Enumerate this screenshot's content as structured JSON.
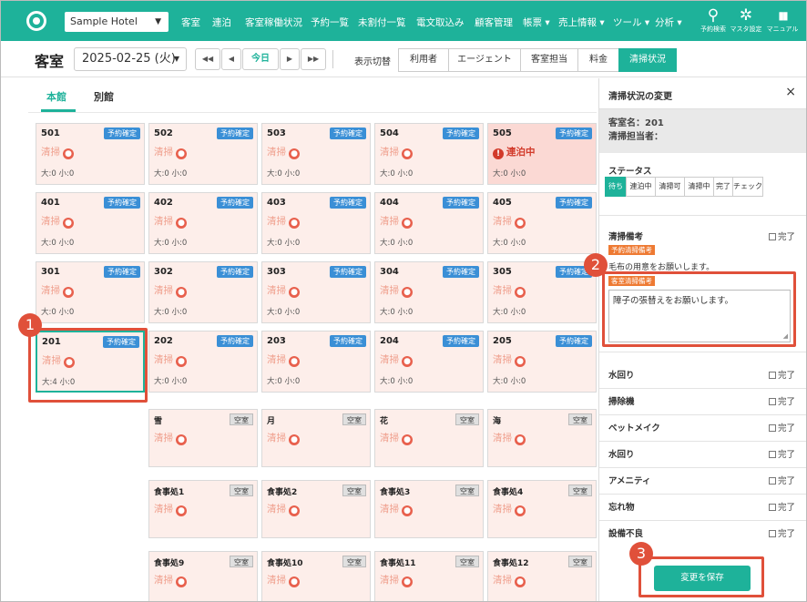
{
  "topnav": {
    "hotel": "Sample Hotel",
    "items": [
      "客室",
      "連泊",
      "客室稼働状況",
      "予約一覧",
      "未割付一覧",
      "電文取込み",
      "顧客管理",
      "帳票 ▾",
      "売上情報 ▾",
      "ツール ▾",
      "分析 ▾"
    ],
    "icons": [
      {
        "name": "search-icon",
        "glyph": "⚲",
        "label": "予約検索"
      },
      {
        "name": "gear-icon",
        "glyph": "✲",
        "label": "マスタ設定"
      },
      {
        "name": "book-icon",
        "glyph": "▮▮",
        "label": "マニュアル"
      }
    ]
  },
  "toolbar": {
    "title": "客室",
    "date": "2025-02-25 (火)",
    "first": "◀◀",
    "prev": "◀",
    "today": "今日",
    "next": "▶",
    "last": "▶▶",
    "display_label": "表示切替",
    "segments": [
      "利用者",
      "エージェント",
      "客室担当",
      "料金",
      "清掃状況"
    ],
    "active_segment": "清掃状況"
  },
  "tabs": [
    "本館",
    "別館"
  ],
  "rooms": [
    [
      {
        "num": "501",
        "badge": "予約確定",
        "status": "清掃",
        "occ": "大:0 小:0"
      },
      {
        "num": "502",
        "badge": "予約確定",
        "status": "清掃",
        "occ": "大:0 小:0"
      },
      {
        "num": "503",
        "badge": "予約確定",
        "status": "清掃",
        "occ": "大:0 小:0"
      },
      {
        "num": "504",
        "badge": "予約確定",
        "status": "清掃",
        "occ": "大:0 小:0"
      },
      {
        "num": "505",
        "badge": "予約確定",
        "status": "連泊中",
        "occ": "大:0 小:0",
        "alert": true
      }
    ],
    [
      {
        "num": "401",
        "badge": "予約確定",
        "status": "清掃",
        "occ": "大:0 小:0"
      },
      {
        "num": "402",
        "badge": "予約確定",
        "status": "清掃",
        "occ": "大:0 小:0"
      },
      {
        "num": "403",
        "badge": "予約確定",
        "status": "清掃",
        "occ": "大:0 小:0"
      },
      {
        "num": "404",
        "badge": "予約確定",
        "status": "清掃",
        "occ": "大:0 小:0"
      },
      {
        "num": "405",
        "badge": "予約確定",
        "status": "清掃",
        "occ": "大:0 小:0"
      }
    ],
    [
      {
        "num": "301",
        "badge": "予約確定",
        "status": "清掃",
        "occ": "大:0 小:0"
      },
      {
        "num": "302",
        "badge": "予約確定",
        "status": "清掃",
        "occ": "大:0 小:0"
      },
      {
        "num": "303",
        "badge": "予約確定",
        "status": "清掃",
        "occ": "大:0 小:0"
      },
      {
        "num": "304",
        "badge": "予約確定",
        "status": "清掃",
        "occ": "大:0 小:0"
      },
      {
        "num": "305",
        "badge": "予約確定",
        "status": "清掃",
        "occ": "大:0 小:0"
      }
    ],
    [
      {
        "num": "201",
        "badge": "予約確定",
        "status": "清掃",
        "occ": "大:4 小:0",
        "selected": true
      },
      {
        "num": "202",
        "badge": "予約確定",
        "status": "清掃",
        "occ": "大:0 小:0"
      },
      {
        "num": "203",
        "badge": "予約確定",
        "status": "清掃",
        "occ": "大:0 小:0"
      },
      {
        "num": "204",
        "badge": "予約確定",
        "status": "清掃",
        "occ": "大:0 小:0"
      },
      {
        "num": "205",
        "badge": "予約確定",
        "status": "清掃",
        "occ": "大:0 小:0"
      }
    ]
  ],
  "facilities": [
    [
      {
        "num": "雪",
        "badge": "空室",
        "status": "清掃"
      },
      {
        "num": "月",
        "badge": "空室",
        "status": "清掃"
      },
      {
        "num": "花",
        "badge": "空室",
        "status": "清掃"
      },
      {
        "num": "海",
        "badge": "空室",
        "status": "清掃"
      }
    ],
    [
      {
        "num": "食事処1",
        "badge": "空室",
        "status": "清掃"
      },
      {
        "num": "食事処2",
        "badge": "空室",
        "status": "清掃"
      },
      {
        "num": "食事処3",
        "badge": "空室",
        "status": "清掃"
      },
      {
        "num": "食事処4",
        "badge": "空室",
        "status": "清掃"
      }
    ],
    [
      {
        "num": "食事処9",
        "badge": "空室",
        "status": "清掃"
      },
      {
        "num": "食事処10",
        "badge": "空室",
        "status": "清掃"
      },
      {
        "num": "食事処11",
        "badge": "空室",
        "status": "清掃"
      },
      {
        "num": "食事処12",
        "badge": "空室",
        "status": "清掃"
      }
    ]
  ],
  "panel": {
    "title": "清掃状況の変更",
    "close": "×",
    "room_name": "客室名：201",
    "staff": "清掃担当者：",
    "status_label": "ステータス",
    "status_options": [
      "待ち",
      "連泊中",
      "清掃可",
      "清掃中",
      "完了",
      "チェック"
    ],
    "active_status": "待ち",
    "notes_label": "清掃備考",
    "done_label": "完了",
    "reservation_note_tag": "予約清掃備考",
    "reservation_note": "毛布の用意をお願いします。",
    "room_note_tag": "客室清掃備考",
    "room_note": "障子の張替えをお願いします。",
    "items": [
      "水回り",
      "掃除機",
      "ベットメイク",
      "水回り",
      "アメニティ",
      "忘れ物",
      "設備不良"
    ],
    "save": "変更を保存"
  },
  "annotations": [
    "1",
    "2",
    "3"
  ],
  "colors": {
    "accent": "#1eb29a",
    "badge": "#3a8fd6",
    "annotation": "#e0503a",
    "tag": "#ee7a33",
    "card": "#fdeeea"
  }
}
